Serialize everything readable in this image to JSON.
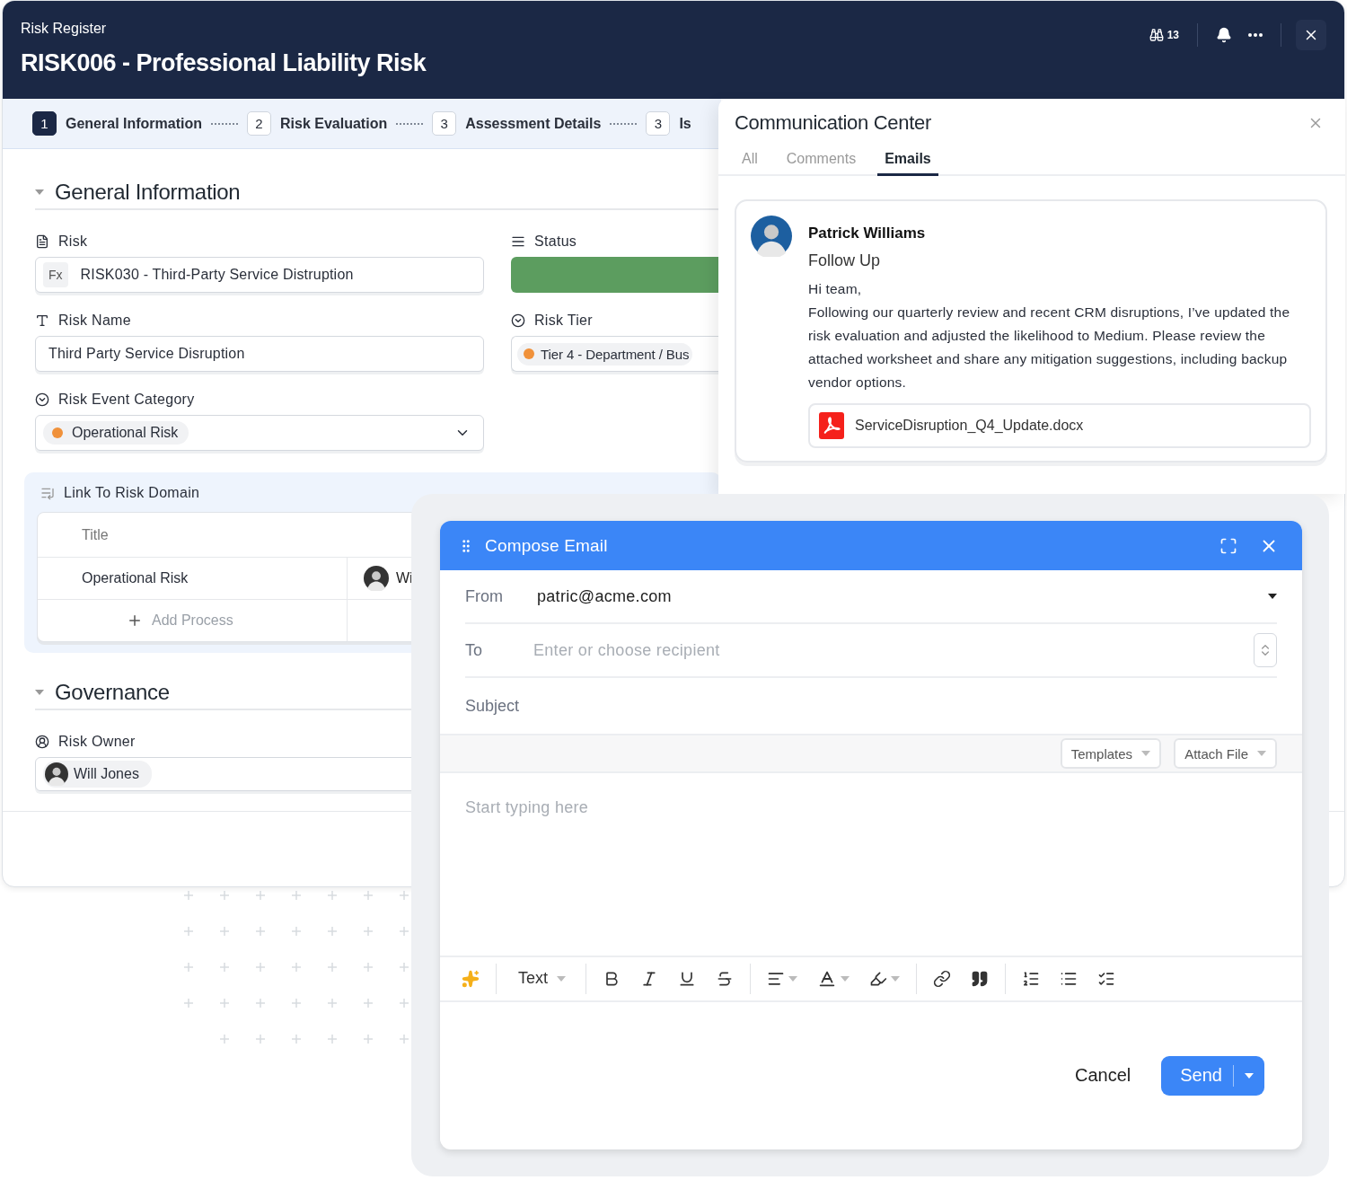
{
  "header": {
    "breadcrumb": "Risk Register",
    "title": "RISK006 - Professional Liability Risk",
    "watchers": "13"
  },
  "steps": [
    {
      "number": "1",
      "label": "General Information",
      "selected": true
    },
    {
      "number": "2",
      "label": "Risk Evaluation",
      "selected": false
    },
    {
      "number": "3",
      "label": "Assessment Details",
      "selected": false
    },
    {
      "number": "3",
      "label": "Is",
      "selected": false
    }
  ],
  "general": {
    "title": "General Information",
    "fields": [
      {
        "kind": "formula",
        "label": "Risk",
        "prefix": "Fx",
        "value": "RISK030 - Third-Party Service Distruption"
      },
      {
        "kind": "status",
        "label": "Status",
        "color": "#5c9d5f"
      },
      {
        "kind": "text",
        "label": "Risk Name",
        "value": "Third Party Service Disruption"
      },
      {
        "kind": "tag",
        "label": "Risk Tier",
        "value": "Tier 4 - Department / Bus",
        "color": "#f0913a"
      },
      {
        "kind": "select",
        "label": "Risk Event Category",
        "value": "Operational Risk",
        "color": "#f0913a"
      }
    ]
  },
  "risk_domain": {
    "title": "Link To Risk Domain",
    "column": "Title",
    "rows": [
      {
        "title": "Operational Risk",
        "owner": "Wi"
      }
    ],
    "add": "Add Process"
  },
  "governance": {
    "title": "Governance",
    "owner_label": "Risk Owner",
    "owner": "Will Jones"
  },
  "communication": {
    "title": "Communication Center",
    "tabs": [
      {
        "label": "All",
        "selected": false
      },
      {
        "label": "Comments",
        "selected": false
      },
      {
        "label": "Emails",
        "selected": true
      }
    ],
    "email": {
      "sender": "Patrick Williams",
      "subject": "Follow Up",
      "greeting": "Hi team,",
      "body": "Following our quarterly review and recent CRM disruptions, I’ve updated the risk evaluation and adjusted the likelihood to Medium. Please review the attached worksheet and share any mitigation suggestions, including backup vendor options.",
      "attachment": "ServiceDisruption_Q4_Update.docx"
    }
  },
  "compose": {
    "title": "Compose Email",
    "from_label": "From",
    "from": "patric@acme.com",
    "to_label": "To",
    "to_placeholder": "Enter or choose recipient",
    "subject_label": "Subject",
    "templates": "Templates",
    "attach": "Attach File",
    "body_placeholder": "Start typing here",
    "text_style": "Text",
    "cancel": "Cancel",
    "send": "Send"
  }
}
